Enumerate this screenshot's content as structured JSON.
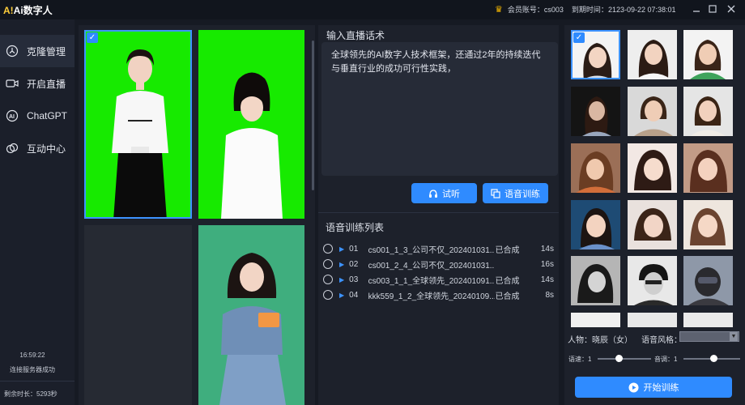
{
  "app": {
    "logo_mark": "A!",
    "title": "Ai数字人",
    "account_label": "会员账号：",
    "account_value": "cs003",
    "expire_label": "到期时间：",
    "expire_value": "2123-09-22 07:38:01"
  },
  "sidebar": {
    "items": [
      {
        "label": "克隆管理",
        "icon": "clone-icon"
      },
      {
        "label": "开启直播",
        "icon": "video-camera-icon"
      },
      {
        "label": "ChatGPT",
        "icon": "ai-icon"
      },
      {
        "label": "互动中心",
        "icon": "interaction-icon"
      }
    ],
    "time": "16:59:22",
    "server_status": "连接服务器成功",
    "remaining": "剩余时长：5293秒"
  },
  "center": {
    "script_title": "输入直播话术",
    "script_text": "全球领先的AI数字人技术框架，还通过2年的持续迭代与垂直行业的成功可行性实践，",
    "listen_button": "试听",
    "train_button": "语音训练",
    "voice_list_title": "语音训练列表",
    "voices": [
      {
        "num": "01",
        "name": "cs001_1_3_公司不仅_202401031...",
        "status": "已合成",
        "duration": "14s"
      },
      {
        "num": "02",
        "name": "cs001_2_4_公司不仅_202401031...",
        "status": "",
        "duration": "16s"
      },
      {
        "num": "03",
        "name": "cs003_1_1_全球领先_202401091...",
        "status": "已合成",
        "duration": "14s"
      },
      {
        "num": "04",
        "name": "kkk559_1_2_全球领先_20240109...",
        "status": "已合成",
        "duration": "8s"
      }
    ]
  },
  "right": {
    "person_label": "人物：晓辰（女）",
    "voice_style_label": "语音风格：",
    "voice_style_value": "",
    "speed_label": "语速：1",
    "volume_label": "音调：1",
    "speed_level": 0.5,
    "volume_level": 0.5,
    "start_button": "开始训练"
  },
  "colors": {
    "accent": "#2f8bff",
    "green_screen": "#17ea00",
    "green_screen_soft": "#3fae7e"
  }
}
